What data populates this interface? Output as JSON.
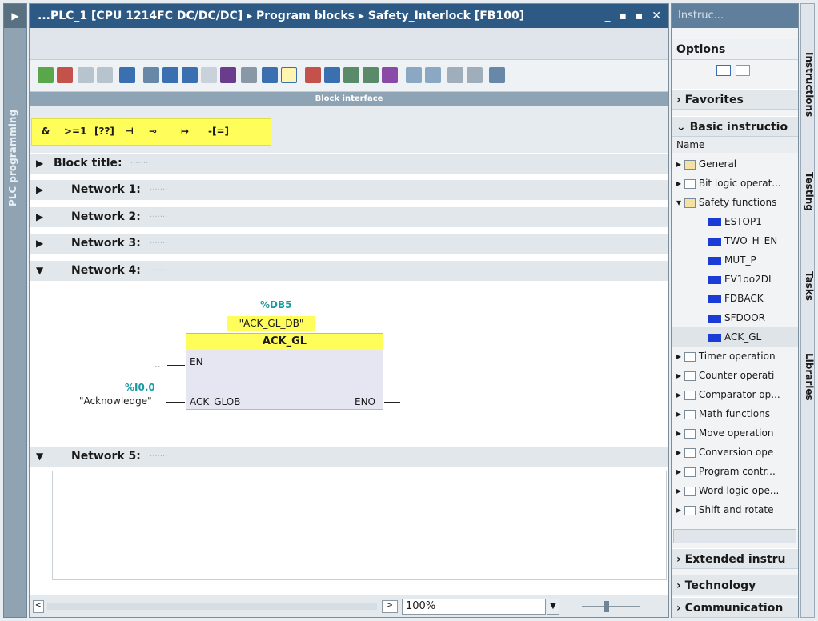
{
  "left_panel": {
    "label": "PLC programming"
  },
  "editor": {
    "breadcrumb": "...PLC_1 [CPU 1214FC DC/DC/DC] ▸ Program blocks ▸ Safety_Interlock [FB100]",
    "window_controls": "_ ▪ ▪ ✕",
    "block_interface_label": "Block interface",
    "ladder_elements": [
      "&",
      ">=1",
      "[??]",
      "⊣",
      "⊸",
      "↦",
      "-[=]"
    ],
    "block_title": "Block title:",
    "networks": [
      {
        "label": "Network 1:",
        "expanded": false
      },
      {
        "label": "Network 2:",
        "expanded": false
      },
      {
        "label": "Network 3:",
        "expanded": false
      },
      {
        "label": "Network 4:",
        "expanded": true
      },
      {
        "label": "Network 5:",
        "expanded": true
      }
    ],
    "network4": {
      "db_address": "%DB5",
      "db_name": "\"ACK_GL_DB\"",
      "block_name": "ACK_GL",
      "en_pin": "EN",
      "en_input": "...",
      "input_pin": "ACK_GLOB",
      "input_address": "%I0.0",
      "input_tag": "\"Acknowledge\"",
      "output_pin": "ENO"
    },
    "statusbar": {
      "zoom": "100%"
    }
  },
  "right_panel": {
    "title": "Instruc...",
    "options_label": "Options",
    "favorites": "Favorites",
    "basic": "Basic instructio",
    "name_header": "Name",
    "tree": [
      {
        "label": "General"
      },
      {
        "label": "Bit logic operat..."
      },
      {
        "label": "Safety functions"
      },
      {
        "label": "ESTOP1"
      },
      {
        "label": "TWO_H_EN"
      },
      {
        "label": "MUT_P"
      },
      {
        "label": "EV1oo2DI"
      },
      {
        "label": "FDBACK"
      },
      {
        "label": "SFDOOR"
      },
      {
        "label": "ACK_GL"
      },
      {
        "label": "Timer operation"
      },
      {
        "label": "Counter operati"
      },
      {
        "label": "Comparator op..."
      },
      {
        "label": "Math functions"
      },
      {
        "label": "Move operation"
      },
      {
        "label": "Conversion ope"
      },
      {
        "label": "Program contr..."
      },
      {
        "label": "Word logic ope..."
      },
      {
        "label": "Shift and rotate"
      }
    ],
    "extended": "Extended instru",
    "technology": "Technology",
    "communication": "Communication"
  },
  "side_tabs": [
    "Instructions",
    "Testing",
    "Tasks",
    "Libraries"
  ],
  "colors": {
    "accent_yellow": "#fffd5a",
    "teal": "#1a9aa5",
    "titlebar": "#2d5a84"
  }
}
